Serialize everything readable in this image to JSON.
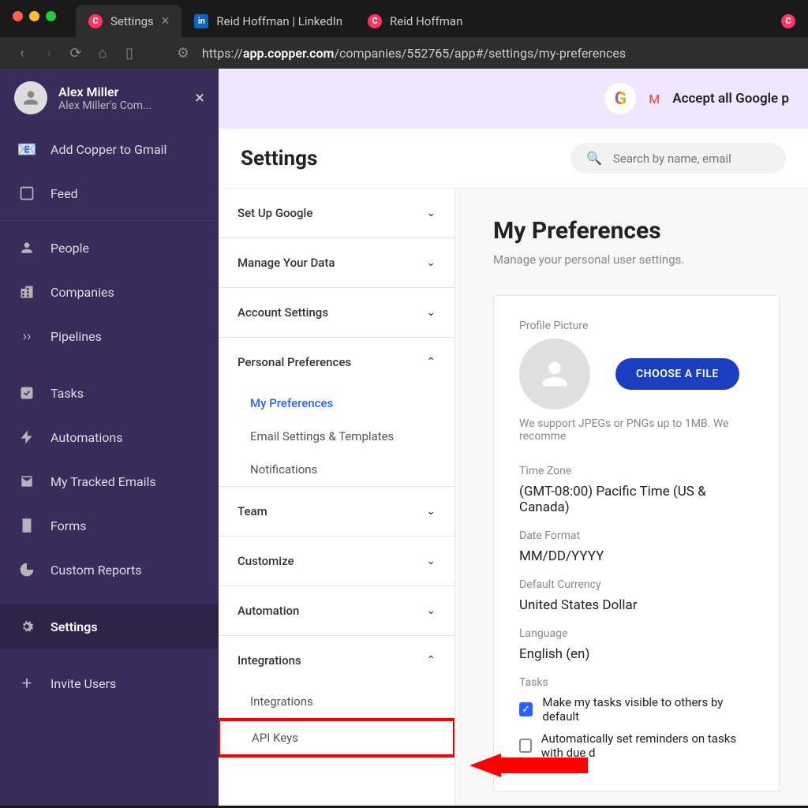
{
  "browser": {
    "tabs": [
      {
        "label": "Settings",
        "icon": "copper"
      },
      {
        "label": "Reid Hoffman | LinkedIn",
        "icon": "linkedin"
      },
      {
        "label": "Reid Hoffman",
        "icon": "copper"
      }
    ],
    "url_prefix": "https://",
    "url_domain": "app.copper.com",
    "url_path": "/companies/552765/app#/settings/my-preferences"
  },
  "sidebar": {
    "profile_name": "Alex Miller",
    "profile_sub": "Alex Miller's Com...",
    "items": [
      {
        "label": "Add Copper to Gmail",
        "icon": "gmail"
      },
      {
        "label": "Feed",
        "icon": "feed"
      },
      {
        "label": "People",
        "icon": "person"
      },
      {
        "label": "Companies",
        "icon": "building"
      },
      {
        "label": "Pipelines",
        "icon": "pipeline"
      },
      {
        "label": "Tasks",
        "icon": "check"
      },
      {
        "label": "Automations",
        "icon": "bolt"
      },
      {
        "label": "My Tracked Emails",
        "icon": "mail"
      },
      {
        "label": "Forms",
        "icon": "form"
      },
      {
        "label": "Custom Reports",
        "icon": "chart"
      },
      {
        "label": "Settings",
        "icon": "gear"
      },
      {
        "label": "Invite Users",
        "icon": "plus"
      }
    ]
  },
  "banner": {
    "text": "Accept all Google p"
  },
  "header": {
    "title": "Settings",
    "search_placeholder": "Search by name, email"
  },
  "settings_nav": {
    "sections": [
      {
        "label": "Set Up Google",
        "expanded": false
      },
      {
        "label": "Manage Your Data",
        "expanded": false
      },
      {
        "label": "Account Settings",
        "expanded": false
      },
      {
        "label": "Personal Preferences",
        "expanded": true,
        "subs": [
          {
            "label": "My Preferences",
            "active": true
          },
          {
            "label": "Email Settings & Templates"
          },
          {
            "label": "Notifications"
          }
        ]
      },
      {
        "label": "Team",
        "expanded": false
      },
      {
        "label": "Customize",
        "expanded": false
      },
      {
        "label": "Automation",
        "expanded": false
      },
      {
        "label": "Integrations",
        "expanded": true,
        "subs": [
          {
            "label": "Integrations"
          },
          {
            "label": "API Keys",
            "highlighted": true
          }
        ]
      }
    ]
  },
  "prefs": {
    "title": "My Preferences",
    "subtitle": "Manage your personal user settings.",
    "profile_picture_label": "Profile Picture",
    "choose_file": "CHOOSE A FILE",
    "upload_help": "We support JPEGs or PNGs up to 1MB. We recomme",
    "fields": [
      {
        "label": "Time Zone",
        "value": "(GMT-08:00) Pacific Time (US & Canada)"
      },
      {
        "label": "Date Format",
        "value": "MM/DD/YYYY"
      },
      {
        "label": "Default Currency",
        "value": "United States Dollar"
      },
      {
        "label": "Language",
        "value": "English (en)"
      }
    ],
    "tasks_label": "Tasks",
    "task_checks": [
      {
        "label": "Make my tasks visible to others by default",
        "checked": true
      },
      {
        "label": "Automatically set reminders on tasks with due d",
        "checked": false
      }
    ]
  }
}
